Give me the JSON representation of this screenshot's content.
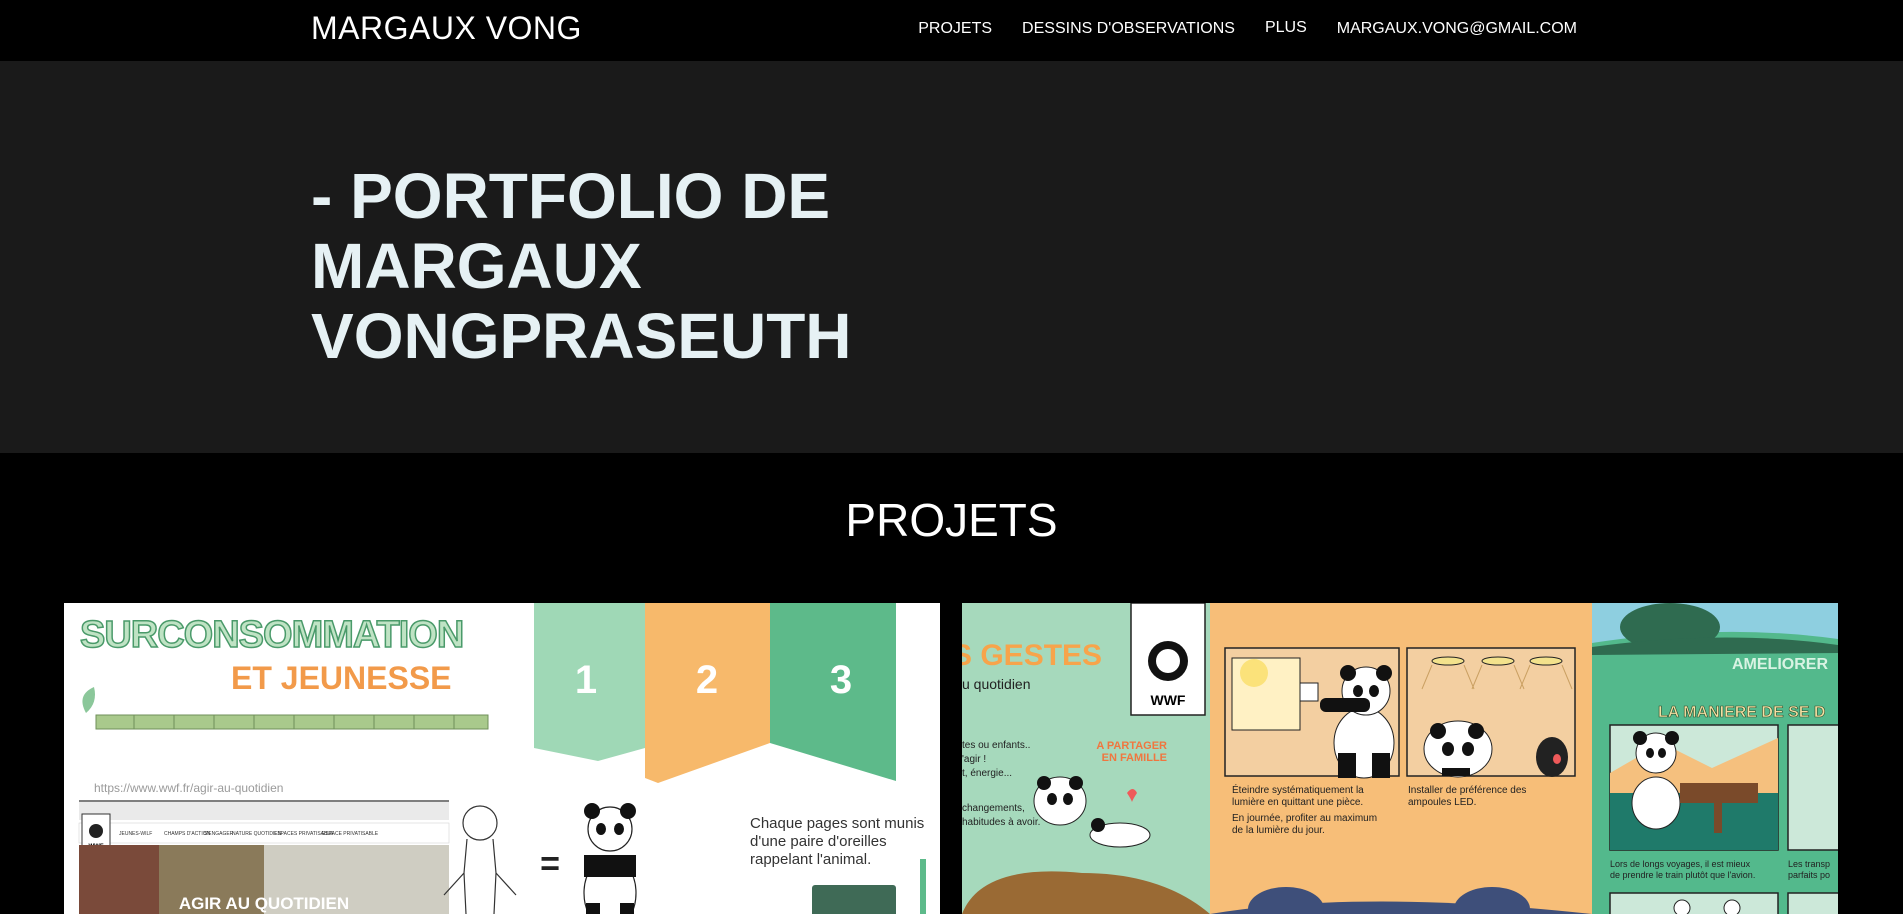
{
  "nav": {
    "brand": "MARGAUX VONG",
    "items": [
      {
        "label": "PROJETS"
      },
      {
        "label": "DESSINS D'OBSERVATIONS"
      },
      {
        "label": "PLUS"
      },
      {
        "label": "MARGAUX.VONG@GMAIL.COM"
      }
    ]
  },
  "hero": {
    "title": "- PORTFOLIO DE MARGAUX VONGPRASEUTH"
  },
  "projects": {
    "heading": "PROJETS",
    "card1": {
      "title_line1": "SURCONSOMMATION",
      "title_line2": "ET JEUNESSE",
      "tab1": "1",
      "tab2": "2",
      "tab3": "3",
      "url": "https://www.wwf.fr/agir-au-quotidien",
      "nav_mini": [
        "JEUNES-WILF",
        "CHAMPS D'ACTION",
        "S'ENGAGER",
        "NATURE QUOTIDIEN",
        "ESPACES PRIVATISABLE",
        "ESPACE PRIVATISABLE"
      ],
      "equals": "=",
      "caption": "Chaque pages sont munis d'une paire d'oreilles rappelant l'animal.",
      "banner": "AGIR AU QUOTIDIEN",
      "colors": {
        "green": "#5dba8a",
        "orange": "#f7b96b",
        "light_green": "#9fd8b6"
      }
    },
    "card2": {
      "gestes": "S GESTES",
      "quotidien": "u quotidien",
      "p1": "tes ou enfants..",
      "p2": "'agir !",
      "p3": "t, énergie...",
      "p4": "changements,",
      "p5": "habitudes à avoir.",
      "partager1": "A PARTAGER",
      "partager2": "EN FAMILLE",
      "wwf": "WWF",
      "cap1a": "Éteindre systématiquement la",
      "cap1b": "lumière en quittant une pièce.",
      "cap1c": "En journée, profiter au maximum",
      "cap1d": "de la lumière du jour.",
      "cap2a": "Installer de préférence des",
      "cap2b": "ampoules LED.",
      "ameliorer": "AMELIORER",
      "maniere": "LA MANIERE DE SE D",
      "cap3a": "Lors de longs voyages, il est mieux",
      "cap3b": "de prendre le train plutôt que l'avion.",
      "cap4a": "Les transp",
      "cap4b": "parfaits po"
    }
  }
}
